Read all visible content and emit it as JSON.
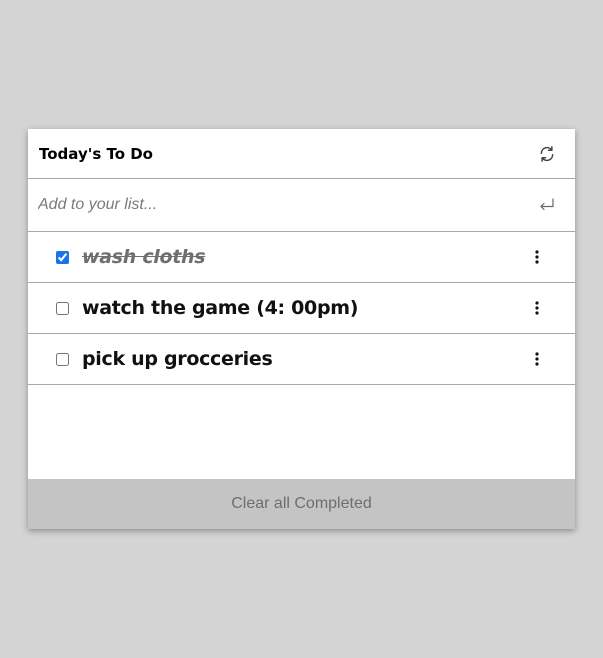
{
  "header": {
    "title": "Today's To Do",
    "refresh_icon": "refresh-icon"
  },
  "add": {
    "placeholder": "Add to your list...",
    "enter_icon": "enter-return-icon"
  },
  "todos": [
    {
      "label": "wash cloths",
      "completed": true
    },
    {
      "label": "watch the game (4: 00pm)",
      "completed": false
    },
    {
      "label": "pick up grocceries",
      "completed": false
    }
  ],
  "footer": {
    "clear_label": "Clear all Completed"
  },
  "colors": {
    "page_background": "#d4d4d4",
    "card_background": "#ffffff",
    "footer_background": "#c4c4c4",
    "checkbox_accent": "#1a73e8"
  }
}
